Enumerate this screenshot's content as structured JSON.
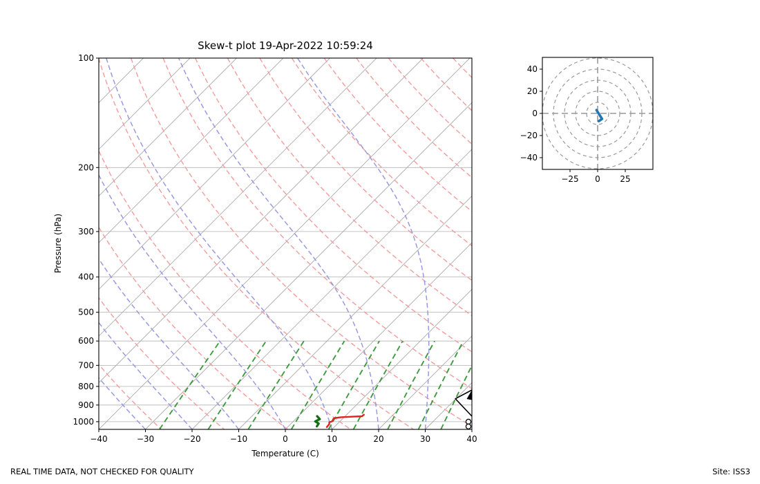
{
  "title": "Skew-t plot 19-Apr-2022 10:59:24",
  "footer": {
    "left": "REAL TIME DATA, NOT CHECKED FOR QUALITY",
    "right": "Site: ISS3"
  },
  "chart_data": {
    "type": "skewt-log-p-with-hodograph-inset",
    "skewt": {
      "xlabel": "Temperature (C)",
      "ylabel": "Pressure (hPa)",
      "x_ticks": [
        -40,
        -30,
        -20,
        -10,
        0,
        10,
        20,
        30,
        40
      ],
      "y_ticks": [
        100,
        200,
        300,
        400,
        500,
        600,
        700,
        800,
        900,
        1000
      ],
      "x_range_c": [
        -40,
        40
      ],
      "p_range_hpa": [
        100,
        1050
      ],
      "isotherms_c": {
        "start": -120,
        "end": 40,
        "step": 10
      },
      "dry_adiabats_theta_c": [
        -30,
        -16.7,
        -3.3,
        10,
        23.3,
        36.7,
        50,
        63.3,
        76.7,
        90,
        103.3,
        116.7,
        130,
        143.3,
        156.7,
        170,
        183.3,
        196.7
      ],
      "moist_adiabats_start_c": [
        -40,
        -30,
        -20,
        -10,
        0,
        10,
        20,
        30,
        40,
        50
      ],
      "mixing_ratio_g_kg": [
        0.4,
        1,
        2,
        4,
        7,
        10,
        16,
        24,
        32
      ],
      "mixing_ratio_top_hpa": 600,
      "temperature_trace_p_t": [
        [
          1035,
          8.4
        ],
        [
          1016,
          8.3
        ],
        [
          1004,
          7.9
        ],
        [
          997,
          8.3
        ],
        [
          979,
          8.0
        ],
        [
          975,
          8.7
        ],
        [
          972,
          9.3
        ],
        [
          966,
          13.6
        ],
        [
          957,
          13.7
        ]
      ],
      "dewpoint_trace_p_t": [
        [
          1030,
          6.1
        ],
        [
          1012,
          5.9
        ],
        [
          998,
          4.7
        ],
        [
          984,
          5.2
        ],
        [
          966,
          4.0
        ]
      ],
      "wind_barbs": {
        "calm_circle_p": [
          1000,
          1031
        ],
        "staff_points": [
          {
            "p": 966,
            "on_edge": true
          },
          {
            "p": 865,
            "t": 29.9
          },
          {
            "p": 818,
            "on_edge": true
          }
        ],
        "pennant_at_p": 818
      },
      "colors": {
        "isotherm": "#aaaaaa",
        "pressure_grid": "#b2b2b2",
        "dry_adiabat": "#f29c9c",
        "moist_adiabat": "#989ae0",
        "mixing_ratio": "#3d9b3d",
        "temperature": "#e41f1f",
        "dewpoint": "#127012",
        "barb": "#000000",
        "hodo_ring": "#999999",
        "hodo_trace": "#2077b4"
      }
    },
    "hodograph": {
      "x_ticks": [
        -25,
        0,
        25
      ],
      "y_ticks": [
        -40,
        -20,
        0,
        20,
        40
      ],
      "ring_radii": [
        10,
        20,
        30,
        40,
        50
      ],
      "range": 50,
      "trace_uv": [
        [
          -1,
          3
        ],
        [
          4,
          -5
        ],
        [
          1,
          -7
        ]
      ]
    }
  }
}
